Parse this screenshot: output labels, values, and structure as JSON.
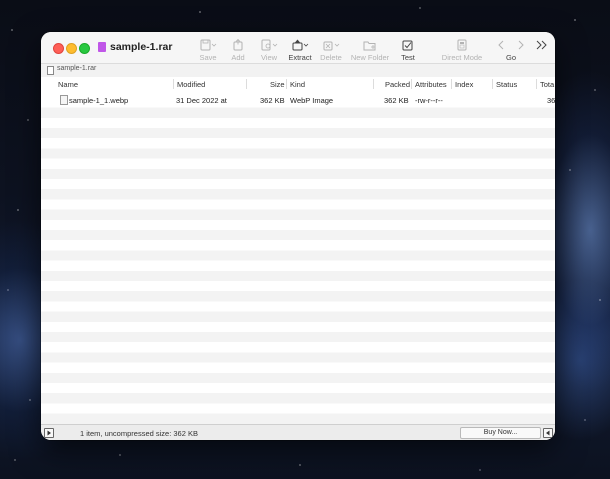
{
  "window": {
    "title": "sample-1.rar",
    "file_icon_color": "#c057e8"
  },
  "toolbar": {
    "items": [
      {
        "label": "Save",
        "icon": "save-icon",
        "enabled": false
      },
      {
        "label": "Add",
        "icon": "add-icon",
        "enabled": false
      },
      {
        "label": "View",
        "icon": "view-icon",
        "enabled": false
      },
      {
        "label": "Extract",
        "icon": "extract-icon",
        "enabled": true
      },
      {
        "label": "Delete",
        "icon": "delete-icon",
        "enabled": false
      },
      {
        "label": "New Folder",
        "icon": "new-folder-icon",
        "enabled": false
      },
      {
        "label": "Test",
        "icon": "test-icon",
        "enabled": true
      },
      {
        "label": "Direct Mode",
        "icon": "direct-mode-icon",
        "enabled": false
      },
      {
        "label": "Go",
        "icon": "go-icon",
        "enabled": true
      }
    ],
    "overflow_icon": "chevron-double-right-icon"
  },
  "pathbar": {
    "path": "sample-1.rar"
  },
  "columns": [
    "Name",
    "Modified",
    "Size",
    "Kind",
    "Packed",
    "Attributes",
    "Index",
    "Status",
    "Tota"
  ],
  "rows": [
    {
      "name": "sample-1_1.webp",
      "modified": "31 Dec 2022 at",
      "size": "362 KB",
      "kind": "WebP Image",
      "packed": "362 KB",
      "attributes": "-rw-r--r--",
      "index": "",
      "status": "",
      "total": "36"
    }
  ],
  "statusbar": {
    "summary": "1 item, uncompressed size: 362 KB",
    "buy_label": "Buy Now..."
  }
}
